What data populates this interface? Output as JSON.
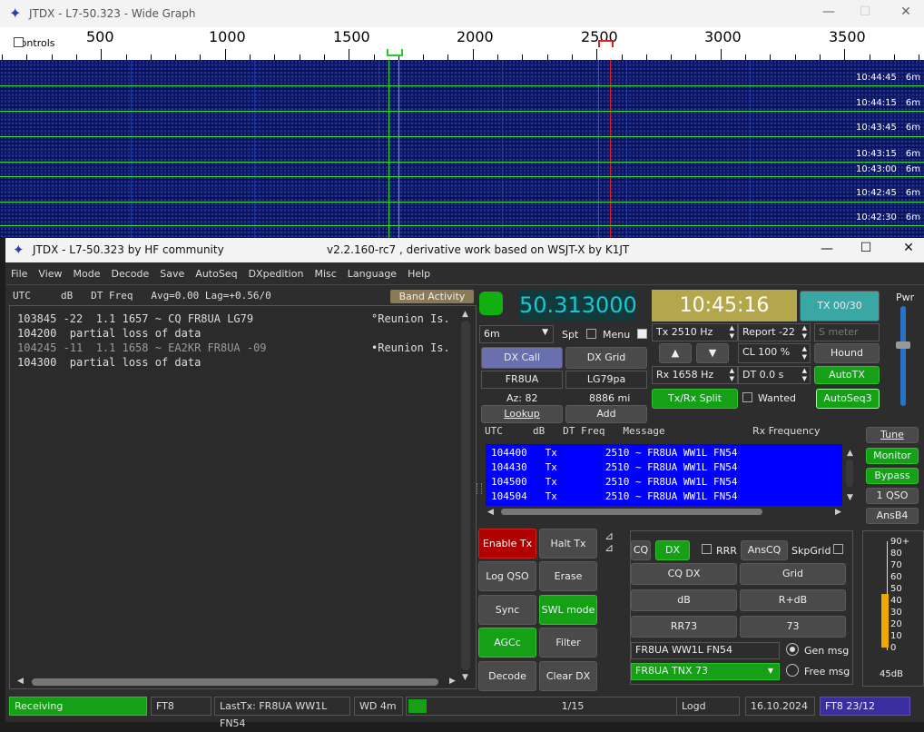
{
  "wide_graph": {
    "title": "JTDX - L7-50.323 - Wide Graph",
    "controls_label": "Controls",
    "scale": [
      "500",
      "1000",
      "1500",
      "2000",
      "2500",
      "3000",
      "3500"
    ],
    "timestamps": [
      {
        "time": "10:44:45",
        "band": "6m"
      },
      {
        "time": "10:44:15",
        "band": "6m"
      },
      {
        "time": "10:43:45",
        "band": "6m"
      },
      {
        "time": "10:43:15",
        "band": "6m"
      },
      {
        "time": "10:43:00",
        "band": "6m"
      },
      {
        "time": "10:42:45",
        "band": "6m"
      },
      {
        "time": "10:42:30",
        "band": "6m"
      }
    ]
  },
  "main": {
    "title_left": "JTDX - L7-50.323  by HF community",
    "title_center": "v2.2.160-rc7 , derivative work based on WSJT-X by K1JT",
    "menu": [
      "File",
      "View",
      "Mode",
      "Decode",
      "Save",
      "AutoSeq",
      "DXpedition",
      "Misc",
      "Language",
      "Help"
    ],
    "band_header": "UTC     dB   DT Freq   Avg=0.00 Lag=+0.56/0",
    "band_activity": "Band Activity",
    "decodes": [
      {
        "text": "103845 -22  1.1 1657 ~ CQ FR8UA LG79",
        "loc": "°Reunion Is.",
        "dim": false
      },
      {
        "text": "104200  partial loss of data",
        "loc": "",
        "dim": false
      },
      {
        "text": "104245 -11  1.1 1658 ~ EA2KR FR8UA -09",
        "loc": "•Reunion Is.",
        "dim": true
      },
      {
        "text": "104300  partial loss of data",
        "loc": "",
        "dim": false
      }
    ],
    "frequency": "50.313000",
    "clock": "10:45:16",
    "tx_counter": "TX 00/30",
    "pwr": "Pwr",
    "band": "6m",
    "spt": "Spt",
    "menu_label": "Menu",
    "tx_hz": "Tx  2510  Hz",
    "rx_hz": "Rx  1658  Hz",
    "report": "Report -22",
    "s_meter": "S meter",
    "cl": "CL  100 %",
    "dt": "DT  0.0 s",
    "hound": "Hound",
    "autotx": "AutoTX",
    "autoseq3": "AutoSeq3",
    "wanted": "Wanted",
    "txrx_split": "Tx/Rx Split",
    "up": "▲",
    "down": "▼",
    "dx_call_btn": "DX Call",
    "dx_grid_btn": "DX Grid",
    "dx_call": "FR8UA",
    "dx_grid": "LG79pa",
    "az": "Az: 82",
    "dist": "8886 mi",
    "lookup": "Lookup",
    "add": "Add",
    "rx_header": "UTC     dB   DT Freq   Message",
    "rx_freq_label": "Rx Frequency",
    "rx_lines": [
      "104400   Tx        2510 ~ FR8UA WW1L FN54",
      "104430   Tx        2510 ~ FR8UA WW1L FN54",
      "104500   Tx        2510 ~ FR8UA WW1L FN54",
      "104504   Tx        2510 ~ FR8UA WW1L FN54"
    ],
    "side_buttons": [
      "Tune",
      "Monitor",
      "Bypass",
      "1 QSO",
      "AnsB4"
    ],
    "grid_buttons": [
      "Enable Tx",
      "Halt Tx",
      "Log QSO",
      "Erase",
      "Sync",
      "SWL mode",
      "AGCc",
      "Filter",
      "Decode",
      "Clear DX"
    ],
    "tx": {
      "cq": "CQ",
      "dx": "DX",
      "rrr": "RRR",
      "anscq": "AnsCQ",
      "skpgrid": "SkpGrid",
      "cq_dx": "CQ DX",
      "grid": "Grid",
      "db": "dB",
      "r_db": "R+dB",
      "rr73": "RR73",
      "s73": "73",
      "msg": "FR8UA WW1L FN54",
      "free": "FR8UA TNX 73",
      "gen_msg": "Gen msg",
      "free_msg": "Free msg"
    },
    "meter_labels": [
      "90+",
      "80",
      "70",
      "60",
      "50",
      "40",
      "30",
      "20",
      "10",
      "0"
    ],
    "meter_value": "45dB",
    "meter_level_db": 45,
    "status": {
      "state": "Receiving",
      "mode": "FT8",
      "lasttx": "LastTx: FR8UA WW1L FN54",
      "wd": "WD 4m",
      "progress": "1/15",
      "logd": "Logd",
      "date": "16.10.2024",
      "ft8": "FT8  23/12"
    }
  }
}
